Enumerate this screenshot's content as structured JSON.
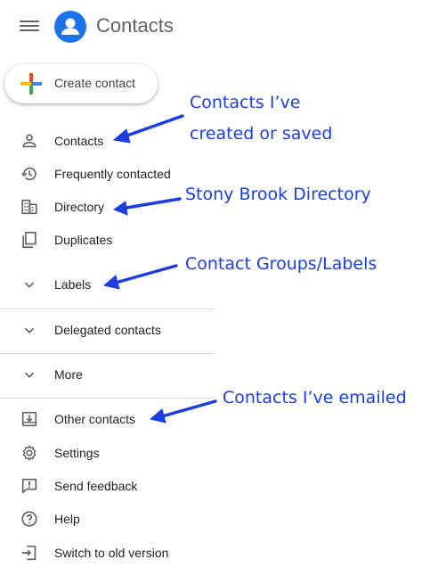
{
  "header": {
    "title": "Contacts"
  },
  "create_button": {
    "label": "Create contact"
  },
  "nav": {
    "contacts": "Contacts",
    "frequently_contacted": "Frequently contacted",
    "directory": "Directory",
    "duplicates": "Duplicates",
    "labels": "Labels",
    "delegated_contacts": "Delegated contacts",
    "more": "More",
    "other_contacts": "Other contacts",
    "settings": "Settings",
    "send_feedback": "Send feedback",
    "help": "Help",
    "switch_old": "Switch to old version"
  },
  "annotations": {
    "contacts_line1": "Contacts I’ve",
    "contacts_line2": "created or saved",
    "directory": "Stony Brook Directory",
    "labels": "Contact Groups/Labels",
    "emailed": "Contacts I’ve emailed"
  },
  "colors": {
    "accent": "#1a73e8",
    "annotation": "#1a3ee0",
    "icon": "#5f6368",
    "divider": "#dadce0"
  }
}
